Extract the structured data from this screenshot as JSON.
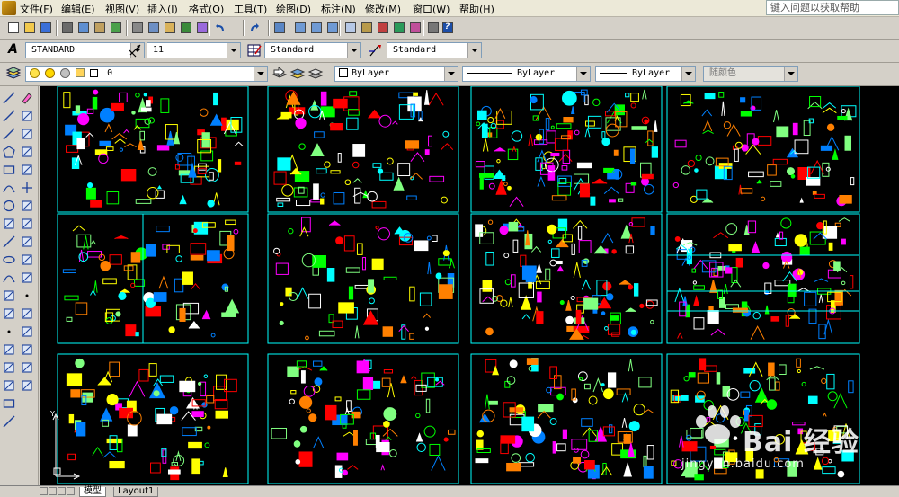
{
  "menu": {
    "items": [
      "文件(F)",
      "编辑(E)",
      "视图(V)",
      "插入(I)",
      "格式(O)",
      "工具(T)",
      "绘图(D)",
      "标注(N)",
      "修改(M)",
      "窗口(W)",
      "帮助(H)"
    ],
    "help_placeholder": "键入问题以获取帮助"
  },
  "styles_toolbar": {
    "text_style": "STANDARD",
    "dim_text_height": "11",
    "dim_style": "Standard",
    "table_style": "Standard"
  },
  "layers_toolbar": {
    "layer_name": "0",
    "color": "ByLayer",
    "linetype": "ByLayer",
    "lineweight": "ByLayer",
    "plot_style": "随颜色"
  },
  "layout_tabs": {
    "model": "模型",
    "layout1": "Layout1"
  },
  "watermark": {
    "brand": "Bai 经验",
    "url": "jingyan.baidu.com"
  },
  "colors": {
    "canvas": "#000000",
    "frame": "#00ffff",
    "chrome": "#d4d0c8"
  },
  "icons": {
    "top_toolbar": [
      "new-icon",
      "open-icon",
      "save-icon",
      "plot-icon",
      "plot-preview-icon",
      "publish-icon",
      "3d-dwf-icon",
      "cut-icon",
      "copy-icon",
      "paste-icon",
      "match-properties-icon",
      "block-editor-icon",
      "undo-icon",
      "redo-icon",
      "pan-icon",
      "zoom-realtime-icon",
      "zoom-window-icon",
      "zoom-previous-icon",
      "properties-icon",
      "design-center-icon",
      "tool-palettes-icon",
      "sheet-set-icon",
      "markup-icon",
      "calculator-icon",
      "help-icon"
    ],
    "draw_toolbar": [
      "line-icon",
      "construction-line-icon",
      "polyline-icon",
      "polygon-icon",
      "rectangle-icon",
      "arc-icon",
      "circle-icon",
      "revision-cloud-icon",
      "spline-icon",
      "ellipse-icon",
      "ellipse-arc-icon",
      "insert-block-icon",
      "make-block-icon",
      "point-icon",
      "hatch-icon",
      "gradient-icon",
      "region-icon",
      "table-icon",
      "multiline-text-icon"
    ],
    "modify_toolbar": [
      "erase-icon",
      "copy-object-icon",
      "mirror-icon",
      "offset-icon",
      "array-icon",
      "move-icon",
      "rotate-icon",
      "scale-icon",
      "stretch-icon",
      "trim-icon",
      "extend-icon",
      "break-at-point-icon",
      "break-icon",
      "join-icon",
      "chamfer-icon",
      "fillet-icon",
      "explode-icon"
    ]
  }
}
